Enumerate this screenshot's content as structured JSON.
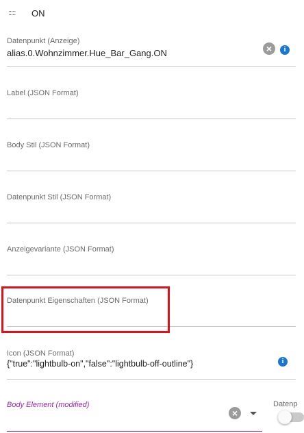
{
  "header": {
    "drag_icon": "drag-handle-icon",
    "title": "ON"
  },
  "fields": [
    {
      "label": "Datenpunkt (Anzeige)",
      "value": "alias.0.Wohnzimmer.Hue_Bar_Gang.ON"
    },
    {
      "label": "Label (JSON Format)",
      "value": ""
    },
    {
      "label": "Body Stil (JSON Format)",
      "value": ""
    },
    {
      "label": "Datenpunkt Stil (JSON Format)",
      "value": ""
    },
    {
      "label": "Anzeigevariante (JSON Format)",
      "value": ""
    },
    {
      "label": "Datenpunkt Eigenschaften (JSON Format)",
      "value": ""
    },
    {
      "label": "Icon (JSON Format)",
      "value": "{\"true\":\"lightbulb-on\",\"false\":\"lightbulb-off-outline\"}"
    },
    {
      "label": "Body Element (modified)",
      "value": ""
    }
  ],
  "side_field": {
    "label": "Datenp"
  },
  "icons": {
    "clear": "×",
    "info": "i"
  },
  "colors": {
    "accent_modified": "#9c27b0",
    "info_blue": "#1976d2",
    "highlight_red": "#e0101a"
  }
}
